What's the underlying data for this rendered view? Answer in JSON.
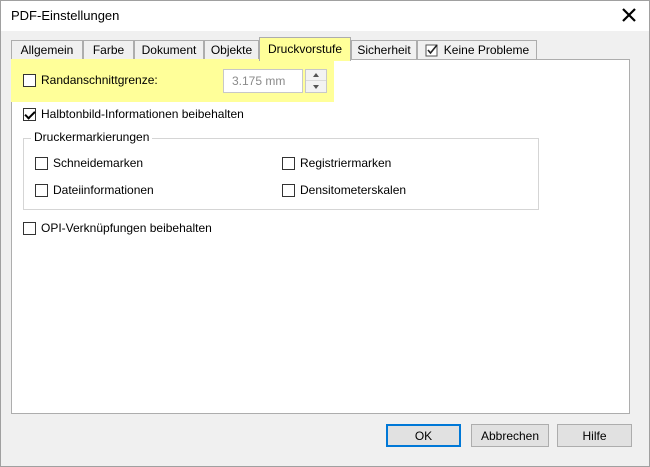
{
  "window": {
    "title": "PDF-Einstellungen",
    "close_icon": "close-icon"
  },
  "tabs": [
    {
      "label": "Allgemein",
      "active": false
    },
    {
      "label": "Farbe",
      "active": false
    },
    {
      "label": "Dokument",
      "active": false
    },
    {
      "label": "Objekte",
      "active": false
    },
    {
      "label": "Druckvorstufe",
      "active": true
    },
    {
      "label": "Sicherheit",
      "active": false
    },
    {
      "label": "Keine Probleme",
      "active": false,
      "icon": "checklist-icon"
    }
  ],
  "bleed": {
    "label": "Randanschnittgrenze:",
    "checked": false,
    "value": "3.175 mm"
  },
  "halftone": {
    "label": "Halbtonbild-Informationen beibehalten",
    "checked": true
  },
  "printer_marks": {
    "legend": "Druckermarkierungen",
    "crop_marks": {
      "label": "Schneidemarken",
      "checked": false
    },
    "registration_marks": {
      "label": "Registriermarken",
      "checked": false
    },
    "file_info": {
      "label": "Dateiinformationen",
      "checked": false
    },
    "densitometer": {
      "label": "Densitometerskalen",
      "checked": false
    }
  },
  "opi": {
    "label": "OPI-Verknüpfungen beibehalten",
    "checked": false
  },
  "buttons": {
    "ok": "OK",
    "cancel": "Abbrechen",
    "help": "Hilfe"
  },
  "colors": {
    "highlight": "#ffff99",
    "default_button_border": "#0078d7"
  }
}
